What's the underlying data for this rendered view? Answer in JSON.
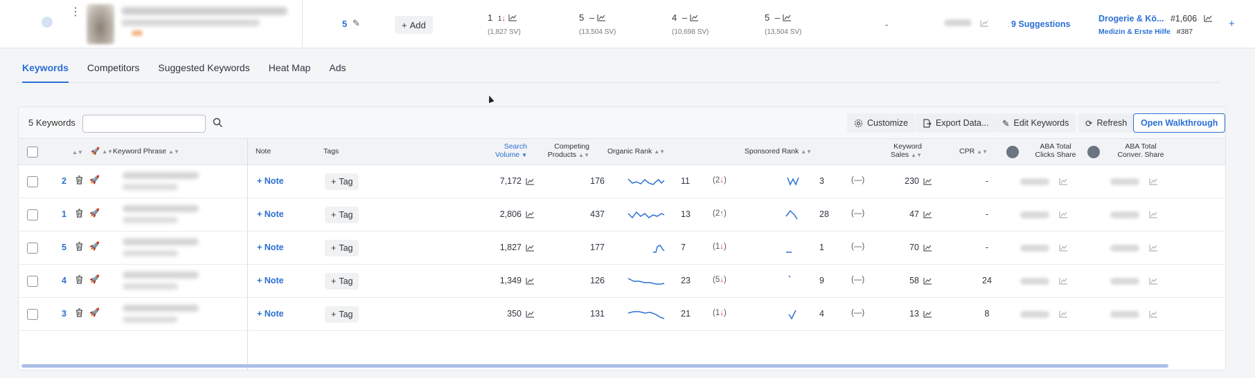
{
  "product": {
    "keyword_count": "5",
    "add_label": "Add",
    "ranks": [
      {
        "value": "1",
        "change": "1",
        "sv": "(1,827 SV)"
      },
      {
        "value": "5",
        "change": "–",
        "sv": "(13,504 SV)"
      },
      {
        "value": "4",
        "change": "–",
        "sv": "(10,698 SV)"
      },
      {
        "value": "5",
        "change": "–",
        "sv": "(13,504 SV)"
      }
    ],
    "dash": "-",
    "suggestions": "9 Suggestions",
    "category_main": "Drogerie & Kö...",
    "category_main_rank": "#1,606",
    "category_sub": "Medizin & Erste Hilfe",
    "category_sub_rank": "#387"
  },
  "tabs": [
    "Keywords",
    "Competitors",
    "Suggested Keywords",
    "Heat Map",
    "Ads"
  ],
  "toolbar": {
    "count_label": "5 Keywords",
    "search_placeholder": "",
    "customize": "Customize",
    "export": "Export Data...",
    "edit": "Edit Keywords",
    "refresh": "Refresh",
    "walkthrough": "Open Walkthrough"
  },
  "columns": {
    "keyword_phrase": "Keyword Phrase",
    "note": "Note",
    "tags": "Tags",
    "search_volume_1": "Search",
    "search_volume_2": "Volume",
    "competing_1": "Competing",
    "competing_2": "Products",
    "organic_rank": "Organic Rank",
    "sponsored_rank": "Sponsored Rank",
    "keyword_sales_1": "Keyword",
    "keyword_sales_2": "Sales",
    "cpr": "CPR",
    "aba_clicks_1": "ABA Total",
    "aba_clicks_2": "Clicks Share",
    "aba_conv_1": "ABA Total",
    "aba_conv_2": "Conver. Share"
  },
  "row_labels": {
    "note": "Note",
    "tag": "Tag",
    "sponsored_delta": "(—)"
  },
  "rows": [
    {
      "rank": "2",
      "search_volume": "7,172",
      "competing": "176",
      "organic_rank": "11",
      "organic_delta": "(2",
      "organic_dir": "down",
      "sponsored_rank": "3",
      "keyword_sales": "230",
      "cpr": "-"
    },
    {
      "rank": "1",
      "search_volume": "2,806",
      "competing": "437",
      "organic_rank": "13",
      "organic_delta": "(2",
      "organic_dir": "up",
      "sponsored_rank": "28",
      "keyword_sales": "47",
      "cpr": "-"
    },
    {
      "rank": "5",
      "search_volume": "1,827",
      "competing": "177",
      "organic_rank": "7",
      "organic_delta": "(1",
      "organic_dir": "down",
      "sponsored_rank": "1",
      "keyword_sales": "70",
      "cpr": "-"
    },
    {
      "rank": "4",
      "search_volume": "1,349",
      "competing": "126",
      "organic_rank": "23",
      "organic_delta": "(5",
      "organic_dir": "down",
      "sponsored_rank": "9",
      "keyword_sales": "58",
      "cpr": "24"
    },
    {
      "rank": "3",
      "search_volume": "350",
      "competing": "131",
      "organic_rank": "21",
      "organic_delta": "(1",
      "organic_dir": "down",
      "sponsored_rank": "4",
      "keyword_sales": "13",
      "cpr": "8"
    }
  ],
  "colors": {
    "accent": "#2a6fd4",
    "down": "#d23a3a"
  }
}
